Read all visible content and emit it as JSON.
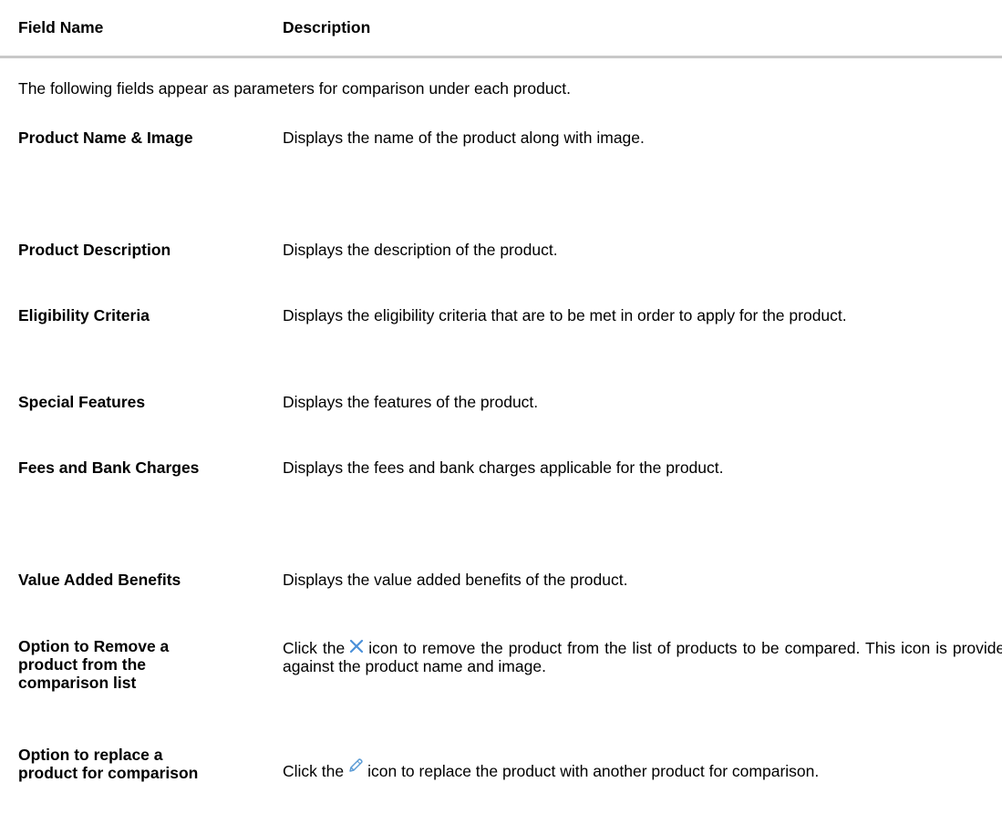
{
  "table": {
    "header": {
      "field_name": "Field Name",
      "description": "Description"
    },
    "intro": "The following fields appear as parameters for comparison under each product.",
    "rows": [
      {
        "field": "Product Name & Image",
        "description": "Displays the name of the product along with image."
      },
      {
        "field": "Product Description",
        "description": "Displays the description of the product."
      },
      {
        "field": "Eligibility Criteria",
        "description": "Displays the eligibility criteria that are to be met in order to apply for the product."
      },
      {
        "field": "Special Features",
        "description": "Displays the features of the product."
      },
      {
        "field": "Fees and Bank Charges",
        "description": "Displays the fees and bank charges applicable for the product."
      },
      {
        "field": "Value Added Benefits",
        "description": "Displays the value added benefits of the product."
      },
      {
        "field": "Option to Remove a product from the comparison list",
        "description_before": "Click the",
        "icon": "close-icon",
        "description_after": "icon to remove the product from the list of products to be compared. This icon is provided against the product name and image."
      },
      {
        "field": "Option to replace a product for comparison",
        "description_before": "Click the",
        "icon": "pencil-edit-icon",
        "description_after": "icon to replace the product with another product for comparison."
      }
    ]
  },
  "colors": {
    "header_rule": "#c8c8c8",
    "close_icon": "#4a90d9",
    "pencil_icon": "#5b9bd5"
  }
}
